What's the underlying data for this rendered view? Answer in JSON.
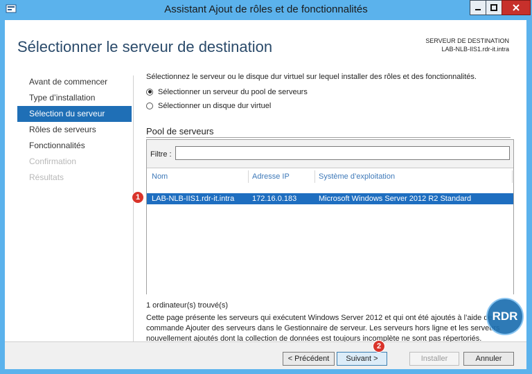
{
  "window": {
    "title": "Assistant Ajout de rôles et de fonctionnalités"
  },
  "header": {
    "page_title": "Sélectionner le serveur de destination",
    "destination_label": "SERVEUR DE DESTINATION",
    "destination_value": "LAB-NLB-IIS1.rdr-it.intra"
  },
  "nav": {
    "items": [
      {
        "label": "Avant de commencer",
        "state": "normal"
      },
      {
        "label": "Type d’installation",
        "state": "normal"
      },
      {
        "label": "Sélection du serveur",
        "state": "active"
      },
      {
        "label": "Rôles de serveurs",
        "state": "normal"
      },
      {
        "label": "Fonctionnalités",
        "state": "normal"
      },
      {
        "label": "Confirmation",
        "state": "disabled"
      },
      {
        "label": "Résultats",
        "state": "disabled"
      }
    ]
  },
  "content": {
    "instruction": "Sélectionnez le serveur ou le disque dur virtuel sur lequel installer des rôles et des fonctionnalités.",
    "radio_pool": "Sélectionner un serveur du pool de serveurs",
    "radio_vhd": "Sélectionner un disque dur virtuel",
    "pool_title": "Pool de serveurs",
    "filter_label": "Filtre :",
    "filter_value": "",
    "columns": [
      "Nom",
      "Adresse IP",
      "Système d’exploitation"
    ],
    "row": {
      "name": "LAB-NLB-IIS1.rdr-it.intra",
      "ip": "172.16.0.183",
      "os": "Microsoft Windows Server 2012 R2 Standard"
    },
    "found": "1 ordinateur(s) trouvé(s)",
    "description": "Cette page présente les serveurs qui exécutent Windows Server 2012 et qui ont été ajoutés à l’aide de la commande Ajouter des serveurs dans le Gestionnaire de serveur. Les serveurs hors ligne et les serveurs nouvellement ajoutés dont la collection de données est toujours incomplète ne sont pas répertoriés."
  },
  "footer": {
    "prev_label": "< Précédent",
    "next_label": "Suivant >",
    "install_label": "Installer",
    "cancel_label": "Annuler"
  },
  "badges": {
    "one": "1",
    "two": "2"
  },
  "logo_text": "RDR",
  "colors": {
    "title_bar": "#5bb2ec",
    "nav_active": "#1f6fb6",
    "row_selected": "#1e6ec0",
    "badge": "#d9342b"
  }
}
